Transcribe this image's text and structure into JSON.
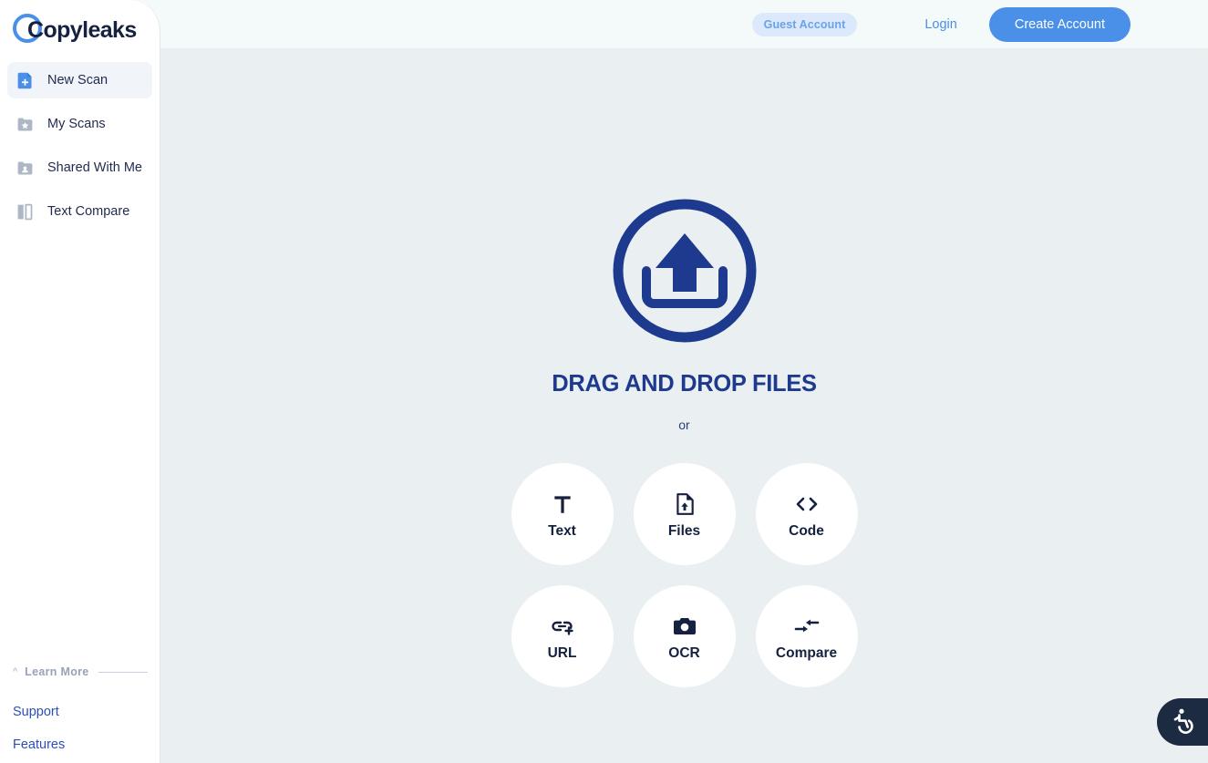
{
  "header": {
    "guest_badge": "Guest Account",
    "login_label": "Login",
    "create_account_label": "Create Account",
    "accent_color": "#4a90e8",
    "badge_bg": "#dce8fb",
    "badge_text_color": "#6aa2e8",
    "background": "#f4fafa"
  },
  "sidebar": {
    "logo_text": "Copyleaks",
    "logo_accent_color": "#4a90e8",
    "logo_text_color": "#16203f",
    "items": [
      {
        "label": "New Scan",
        "icon": "document-plus-icon",
        "active": true
      },
      {
        "label": "My Scans",
        "icon": "folder-star-icon",
        "active": false
      },
      {
        "label": "Shared With Me",
        "icon": "folder-person-icon",
        "active": false
      },
      {
        "label": "Text Compare",
        "icon": "split-document-icon",
        "active": false
      }
    ],
    "learn_more": {
      "title": "Learn More",
      "collapse_icon": "chevron-up-icon",
      "links": [
        "Support",
        "Features"
      ],
      "link_color": "#2a4fb8"
    }
  },
  "main": {
    "upload_icon": "upload-circle-icon",
    "drag_title": "DRAG AND DROP FILES",
    "or_label": "or",
    "title_color": "#1d3a8f",
    "background": "#eaeff1",
    "options": [
      {
        "label": "Text",
        "icon": "text-t-icon"
      },
      {
        "label": "Files",
        "icon": "file-upload-icon"
      },
      {
        "label": "Code",
        "icon": "code-brackets-icon"
      },
      {
        "label": "URL",
        "icon": "link-plus-icon"
      },
      {
        "label": "OCR",
        "icon": "camera-icon"
      },
      {
        "label": "Compare",
        "icon": "compare-arrows-icon"
      }
    ]
  },
  "accessibility": {
    "icon": "accessibility-wheelchair-icon",
    "background": "#1c2a42"
  }
}
